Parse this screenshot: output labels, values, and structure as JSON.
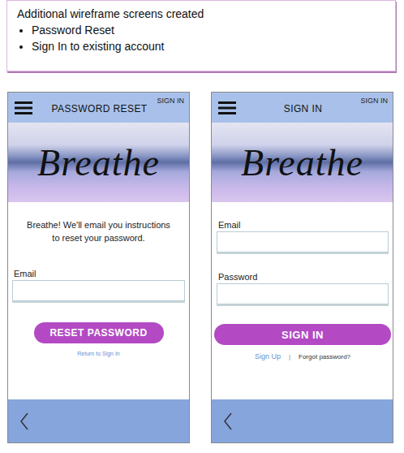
{
  "summary": {
    "title": "Additional wireframe screens created",
    "bullets": [
      "Password Reset",
      "Sign In to existing account"
    ]
  },
  "screens": [
    {
      "kind": "reset",
      "title": "PASSWORD RESET",
      "corner_link": "SIGN IN",
      "logo": "Breathe",
      "message": "Breathe! We'll email you instructions to reset your password.",
      "fields": [
        {
          "label": "Email",
          "value": ""
        }
      ],
      "button": "RESET PASSWORD",
      "links": [
        "Return to Sign In"
      ],
      "link_separator": ""
    },
    {
      "kind": "signin",
      "title": "SIGN IN",
      "corner_link": "SIGN IN",
      "logo": "Breathe",
      "message": "",
      "fields": [
        {
          "label": "Email",
          "value": ""
        },
        {
          "label": "Password",
          "value": ""
        }
      ],
      "button": "SIGN IN",
      "links": [
        "Sign Up",
        "Forgot password?"
      ],
      "link_separator": "|"
    }
  ]
}
